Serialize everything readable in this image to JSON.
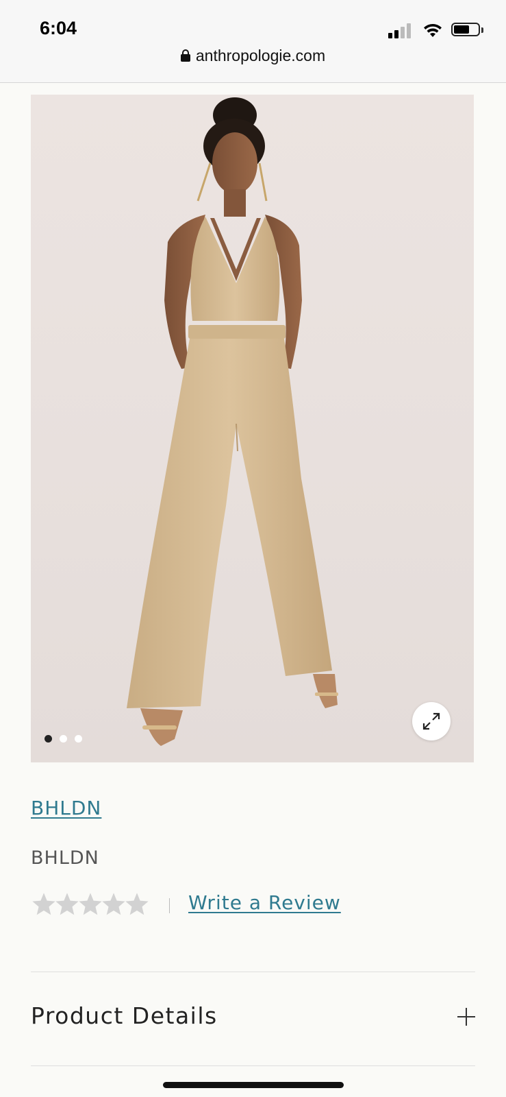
{
  "status_bar": {
    "time": "6:04",
    "url": "anthropologie.com"
  },
  "product": {
    "image_icon": "product-photo-gold-jumpsuit",
    "carousel": {
      "total": 3,
      "active_index": 0
    },
    "brand_link": "BHLDN",
    "brand_name": "BHLDN",
    "rating": {
      "stars_filled": 0,
      "stars_total": 5,
      "write_review_label": "Write a Review"
    },
    "details_label": "Product Details"
  },
  "colors": {
    "link": "#2f7a8f",
    "star_empty": "#d2d2d2",
    "background": "#fafaf7"
  }
}
